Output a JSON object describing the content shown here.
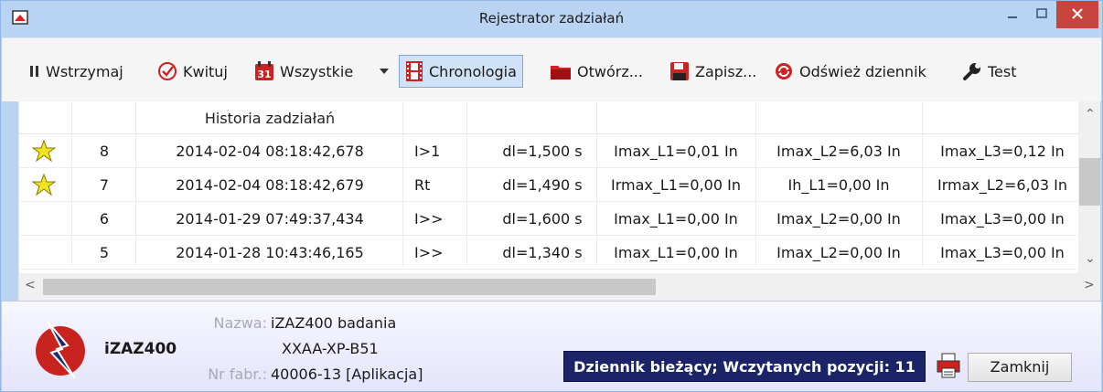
{
  "window": {
    "title": "Rejestrator zadziałań"
  },
  "toolbar": {
    "pause": "Wstrzymaj",
    "ack": "Kwituj",
    "all": "Wszystkie",
    "chrono": "Chronologia",
    "open": "Otwórz...",
    "save": "Zapisz...",
    "refresh": "Odśwież dziennik",
    "test": "Test"
  },
  "table": {
    "header": "Historia zadziałań",
    "rows": [
      {
        "starred": true,
        "num": "8",
        "time": "2014-02-04 08:18:42,678",
        "fn": "I>1",
        "dl": "dl=1,500 s",
        "a": "Imax_L1=0,01 In",
        "b": "Imax_L2=6,03 In",
        "c": "Imax_L3=0,12 In"
      },
      {
        "starred": true,
        "num": "7",
        "time": "2014-02-04 08:18:42,679",
        "fn": "Rt",
        "dl": "dl=1,490 s",
        "a": "Irmax_L1=0,00 In",
        "b": "Ih_L1=0,00 In",
        "c": "Irmax_L2=6,03 In"
      },
      {
        "starred": false,
        "num": "6",
        "time": "2014-01-29 07:49:37,434",
        "fn": "I>>",
        "dl": "dl=1,600 s",
        "a": "Imax_L1=0,00 In",
        "b": "Imax_L2=0,00 In",
        "c": "Imax_L3=0,00 In"
      },
      {
        "starred": false,
        "num": "5",
        "time": "2014-01-28 10:43:46,165",
        "fn": "I>>",
        "dl": "dl=1,340 s",
        "a": "Imax_L1=0,00 In",
        "b": "Imax_L2=0,00 In",
        "c": "Imax_L3=0,00 In"
      }
    ]
  },
  "footer": {
    "device": "iZAZ400",
    "name_label": "Nazwa:",
    "name_value": "iZAZ400 badania",
    "code_value": "XXAA-XP-B51",
    "serial_label": "Nr fabr.:",
    "serial_value": "40006-13 [Aplikacja]",
    "status": "Dziennik bieżący; Wczytanych pozycji: 11",
    "close": "Zamknij"
  },
  "colors": {
    "accent": "#cfe2f8",
    "status_bg": "#1a2466",
    "close_btn": "#c7453c",
    "star": "#f4e320"
  }
}
